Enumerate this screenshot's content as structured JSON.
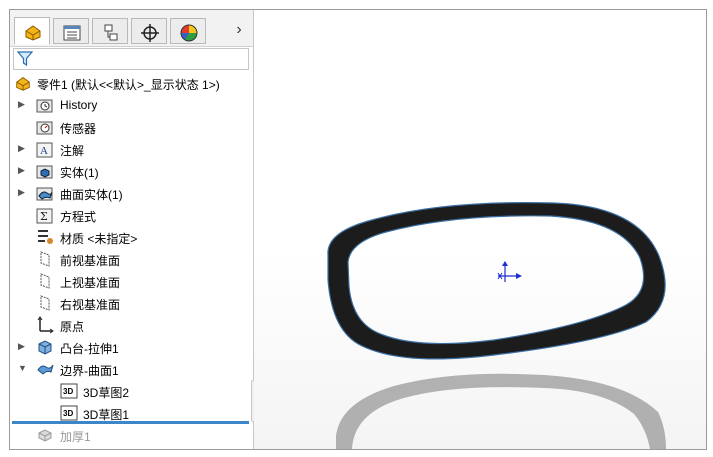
{
  "tabs": [
    {
      "name": "featuremanager",
      "active": true
    },
    {
      "name": "propertymanager",
      "active": false
    },
    {
      "name": "configurationmanager",
      "active": false
    },
    {
      "name": "dimxpertmanager",
      "active": false
    },
    {
      "name": "displaymanager",
      "active": false
    }
  ],
  "tab_more": "›",
  "tree": {
    "root": "零件1 (默认<<默认>_显示状态 1>)",
    "items": [
      {
        "label": "History",
        "expandable": true
      },
      {
        "label": "传感器",
        "expandable": false
      },
      {
        "label": "注解",
        "expandable": true
      },
      {
        "label": "实体(1)",
        "expandable": true
      },
      {
        "label": "曲面实体(1)",
        "expandable": true
      },
      {
        "label": "方程式",
        "expandable": false
      },
      {
        "label": "材质 <未指定>",
        "expandable": false
      },
      {
        "label": "前视基准面",
        "expandable": false
      },
      {
        "label": "上视基准面",
        "expandable": false
      },
      {
        "label": "右视基准面",
        "expandable": false
      },
      {
        "label": "原点",
        "expandable": false
      },
      {
        "label": "凸台-拉伸1",
        "expandable": true
      },
      {
        "label": "边界-曲面1",
        "expandable": true,
        "expanded": true
      },
      {
        "label": "3D草图2",
        "expandable": false
      },
      {
        "label": "3D草图1",
        "expandable": false
      },
      {
        "label": "加厚1",
        "expandable": false,
        "suppressed_below_rollback": true
      }
    ],
    "sketch_badge": "3D"
  },
  "colors": {
    "rollback_bar": "#3a86c8",
    "model_ring": "#1c1c1c",
    "model_edge": "#3b6fa3",
    "reflection": "#a8a8a8",
    "origin_triad": "#1a2fd0"
  }
}
